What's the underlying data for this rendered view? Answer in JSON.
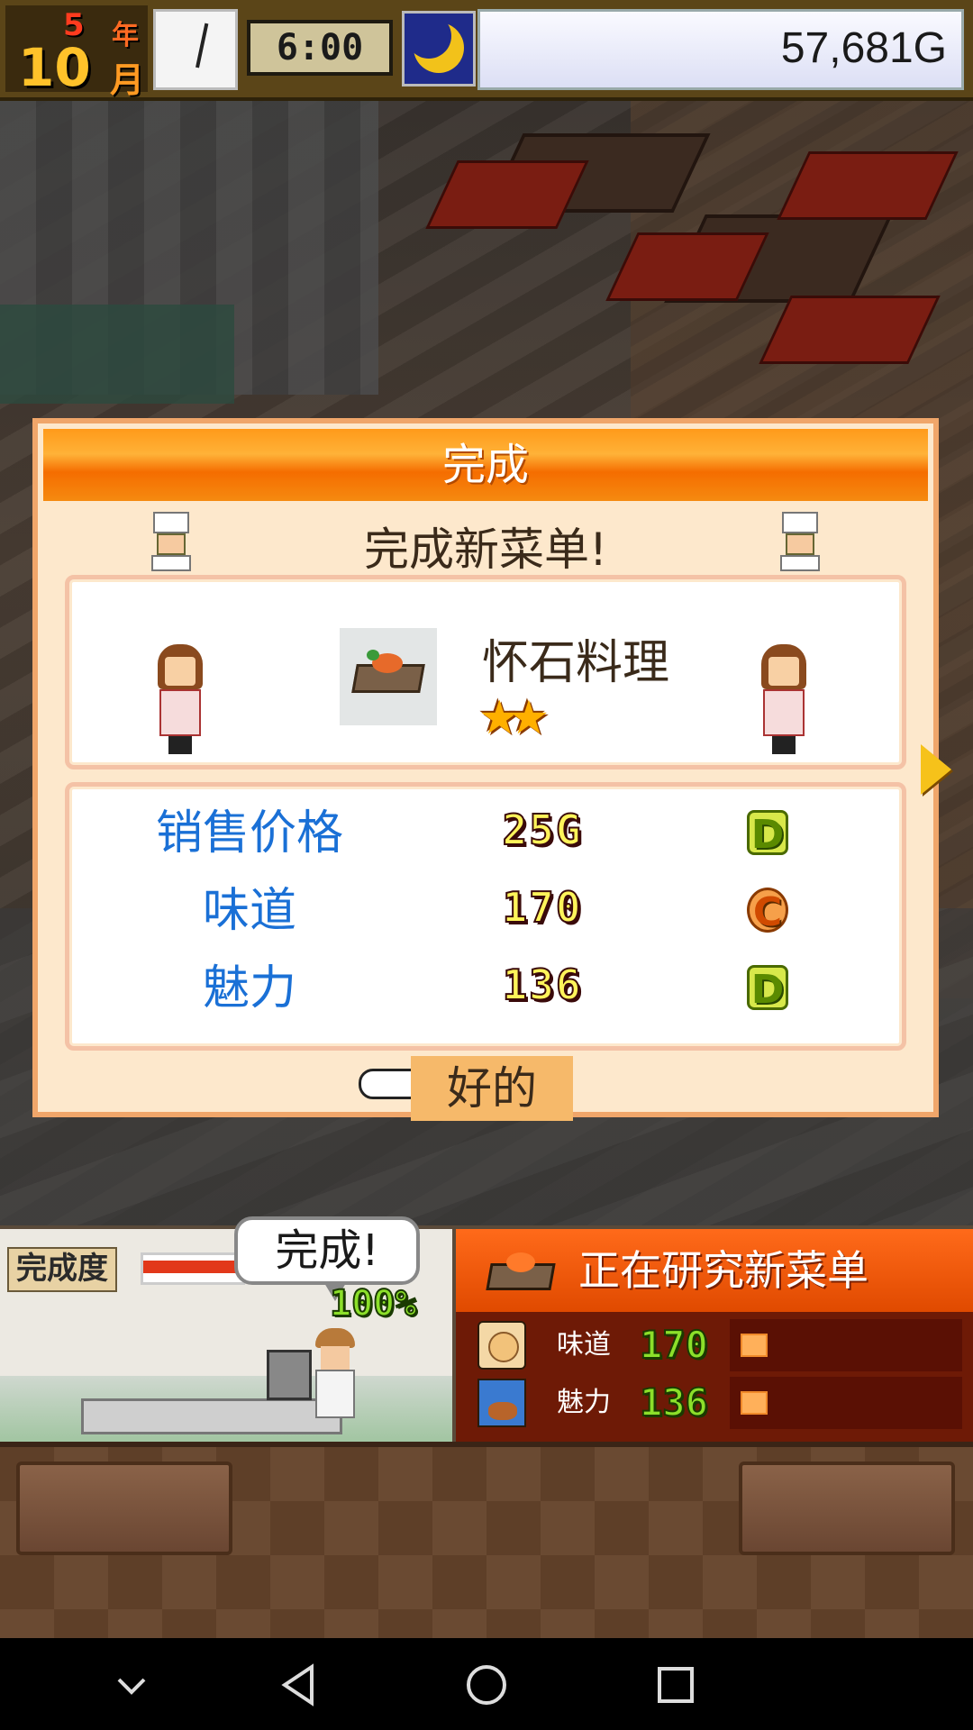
{
  "hud": {
    "year_num": "5",
    "year_unit": "年",
    "month_num": "10",
    "month_unit": "月",
    "time": "6:00",
    "time_of_day_icon": "moon-icon",
    "money": "57,681G"
  },
  "dialog": {
    "title": "完成",
    "subtitle": "完成新菜单!",
    "dish_name": "怀石料理",
    "stars": 2,
    "star_glyphs": [
      "★",
      "★"
    ],
    "stats": [
      {
        "label": "销售价格",
        "value": "25G",
        "grade": "D"
      },
      {
        "label": "味道",
        "value": "170",
        "grade": "C"
      },
      {
        "label": "魅力",
        "value": "136",
        "grade": "D"
      }
    ],
    "ok_label": "好的"
  },
  "status": {
    "progress_label": "完成度",
    "bubble_text": "完成!",
    "percent": "100%",
    "progress_fraction": 1.0,
    "research_title": "正在研究新菜单",
    "rows": [
      {
        "label": "味道",
        "value": "170",
        "icon": "taste-icon"
      },
      {
        "label": "魅力",
        "value": "136",
        "icon": "charm-icon"
      }
    ]
  },
  "colors": {
    "title_orange": "#f56d00",
    "stat_blue": "#1a70d6",
    "grade_d": "#d8e84a",
    "grade_c": "#f6a04a"
  }
}
